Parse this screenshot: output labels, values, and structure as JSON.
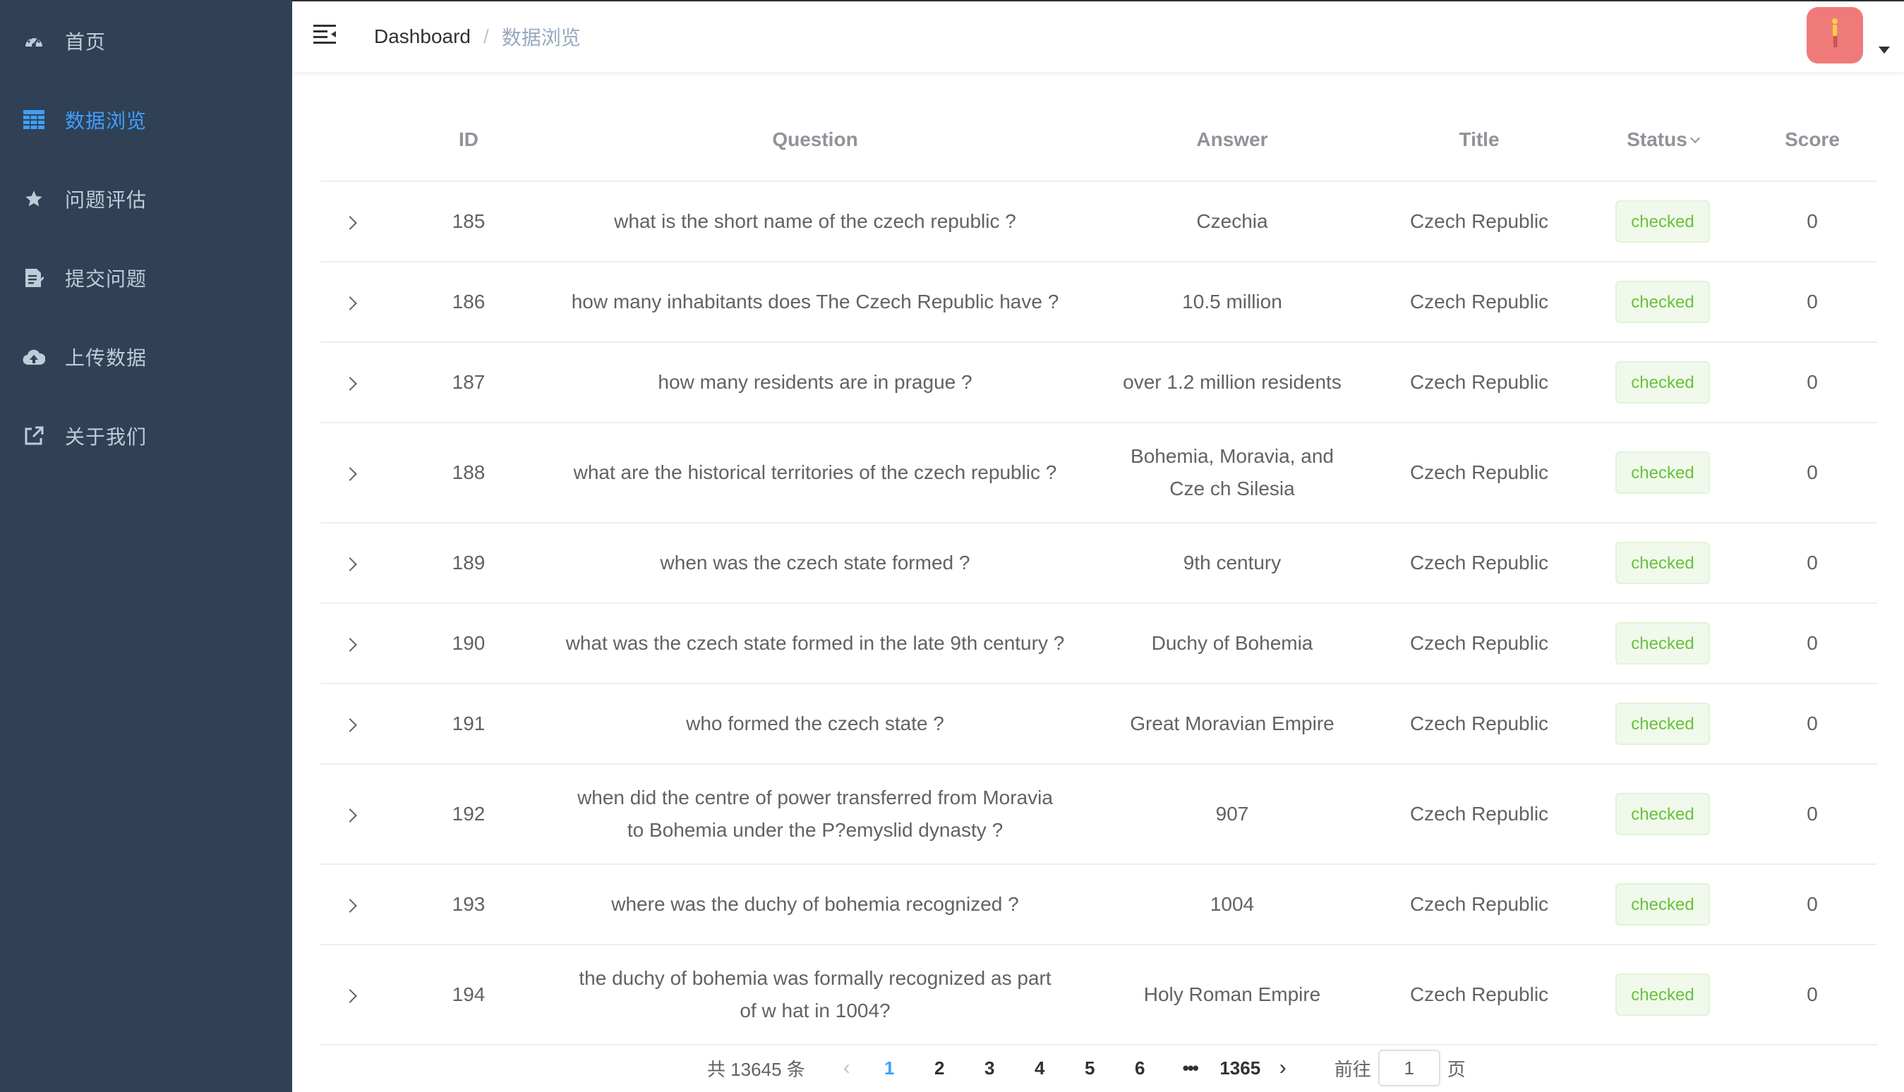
{
  "sidebar": {
    "items": [
      {
        "label": "首页",
        "icon": "dashboard-icon"
      },
      {
        "label": "数据浏览",
        "icon": "table-icon"
      },
      {
        "label": "问题评估",
        "icon": "star-icon"
      },
      {
        "label": "提交问题",
        "icon": "document-icon"
      },
      {
        "label": "上传数据",
        "icon": "cloud-upload-icon"
      },
      {
        "label": "关于我们",
        "icon": "external-link-icon"
      }
    ],
    "active_index": 1
  },
  "header": {
    "breadcrumb": {
      "home": "Dashboard",
      "separator": "/",
      "current": "数据浏览"
    }
  },
  "table": {
    "columns": [
      "ID",
      "Question",
      "Answer",
      "Title",
      "Status",
      "Score"
    ],
    "rows": [
      {
        "id": "185",
        "question": "what is the short name of the czech republic ?",
        "answer": "Czechia",
        "title": "Czech Republic",
        "status": "checked",
        "score": "0"
      },
      {
        "id": "186",
        "question": "how many inhabitants does The Czech Republic have ?",
        "answer": "10.5 million",
        "title": "Czech Republic",
        "status": "checked",
        "score": "0"
      },
      {
        "id": "187",
        "question": "how many residents are in prague ?",
        "answer": "over 1.2 million residents",
        "title": "Czech Republic",
        "status": "checked",
        "score": "0"
      },
      {
        "id": "188",
        "question": "what are the historical territories of the czech republic ?",
        "answer": "Bohemia, Moravia, and Cze ch Silesia",
        "title": "Czech Republic",
        "status": "checked",
        "score": "0"
      },
      {
        "id": "189",
        "question": "when was the czech state formed ?",
        "answer": "9th century",
        "title": "Czech Republic",
        "status": "checked",
        "score": "0"
      },
      {
        "id": "190",
        "question": "what was the czech state formed in the late 9th century ?",
        "answer": "Duchy of Bohemia",
        "title": "Czech Republic",
        "status": "checked",
        "score": "0"
      },
      {
        "id": "191",
        "question": "who formed the czech state ?",
        "answer": "Great Moravian Empire",
        "title": "Czech Republic",
        "status": "checked",
        "score": "0"
      },
      {
        "id": "192",
        "question": "when did the centre of power transferred from Moravia to Bohemia under the P?emyslid dynasty ?",
        "answer": "907",
        "title": "Czech Republic",
        "status": "checked",
        "score": "0"
      },
      {
        "id": "193",
        "question": "where was the duchy of bohemia recognized ?",
        "answer": "1004",
        "title": "Czech Republic",
        "status": "checked",
        "score": "0"
      },
      {
        "id": "194",
        "question": "the duchy of bohemia was formally recognized as part of w hat in 1004?",
        "answer": "Holy Roman Empire",
        "title": "Czech Republic",
        "status": "checked",
        "score": "0"
      }
    ]
  },
  "pagination": {
    "total_label": "共 13645 条",
    "pages": [
      "1",
      "2",
      "3",
      "4",
      "5",
      "6"
    ],
    "ellipsis": "•••",
    "last_page": "1365",
    "current_page": "1",
    "goto_prefix": "前往",
    "goto_suffix": "页",
    "goto_value": "1"
  },
  "colors": {
    "sidebar_bg": "#304156",
    "sidebar_text": "#bfcbd9",
    "accent": "#409eff",
    "tag_success": "#67c23a"
  }
}
